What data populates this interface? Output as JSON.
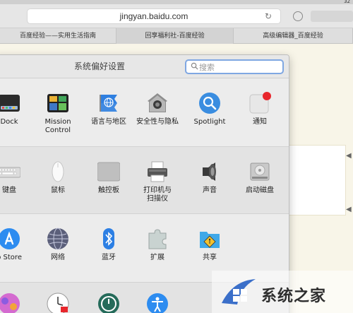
{
  "browser": {
    "status_text": "32",
    "url": "jingyan.baidu.com",
    "reload_icon": "reload-icon"
  },
  "tabs": [
    {
      "label": "百度经验——实用生活指南"
    },
    {
      "label": "回享福利社-百度经验"
    },
    {
      "label": "高级编辑器_百度经验"
    }
  ],
  "sysprefs": {
    "title": "系统偏好设置",
    "search_placeholder": "搜索",
    "rows": [
      {
        "items": [
          {
            "label": "Dock",
            "icon": "dock-icon"
          },
          {
            "label": "Mission\nControl",
            "icon": "mission-control-icon"
          },
          {
            "label": "语言与地区",
            "icon": "language-region-icon"
          },
          {
            "label": "安全性与隐私",
            "icon": "security-privacy-icon"
          },
          {
            "label": "Spotlight",
            "icon": "spotlight-icon"
          },
          {
            "label": "通知",
            "icon": "notifications-icon"
          }
        ]
      },
      {
        "items": [
          {
            "label": "键盘",
            "icon": "keyboard-icon"
          },
          {
            "label": "鼠标",
            "icon": "mouse-icon"
          },
          {
            "label": "触控板",
            "icon": "trackpad-icon"
          },
          {
            "label": "打印机与\n扫描仪",
            "icon": "printer-scanner-icon"
          },
          {
            "label": "声音",
            "icon": "sound-icon"
          },
          {
            "label": "启动磁盘",
            "icon": "startup-disk-icon"
          }
        ]
      },
      {
        "items": [
          {
            "label": "p Store",
            "icon": "app-store-icon"
          },
          {
            "label": "网络",
            "icon": "network-icon"
          },
          {
            "label": "蓝牙",
            "icon": "bluetooth-icon"
          },
          {
            "label": "扩展",
            "icon": "extensions-icon"
          },
          {
            "label": "共享",
            "icon": "sharing-icon"
          }
        ]
      }
    ]
  },
  "watermark": {
    "text": "系统之家"
  },
  "colors": {
    "accent": "#7fa7e2",
    "notification_red": "#e8262c",
    "spotlight_blue": "#3a8de0"
  }
}
